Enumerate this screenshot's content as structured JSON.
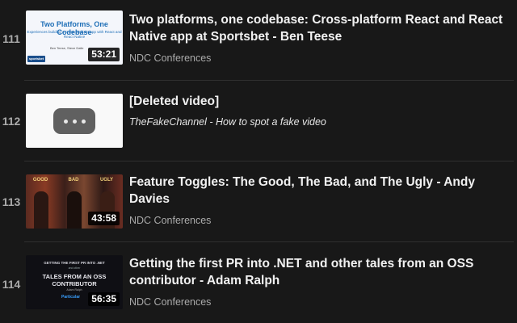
{
  "playlist": {
    "items": [
      {
        "index": "111",
        "title": "Two platforms, one codebase: Cross-platform React and React Native app at Sportsbet - Ben Teese",
        "channel": "NDC Conferences",
        "duration": "53:21",
        "thumb": {
          "heading": "Two Platforms, One Codebase",
          "subtitle": "Experiences building a cross-platform app with React and React Native",
          "author": "Ben Teese, Steve Dalle",
          "logo_text": "sportsbet"
        }
      },
      {
        "index": "112",
        "title": "[Deleted video]",
        "channel": "TheFakeChannel - How to spot a fake video",
        "duration": "",
        "thumb": {}
      },
      {
        "index": "113",
        "title": "Feature Toggles: The Good, The Bad, and The Ugly - Andy Davies",
        "channel": "NDC Conferences",
        "duration": "43:58",
        "thumb": {
          "labels": [
            "GOOD",
            "BAD",
            "UGLY"
          ]
        }
      },
      {
        "index": "114",
        "title": "Getting the first PR into .NET and other tales from an OSS contributor - Adam Ralph",
        "channel": "NDC Conferences",
        "duration": "56:35",
        "thumb": {
          "line1": "GETTING THE FIRST PR INTO .NET",
          "line2": "and other",
          "big": "TALES FROM AN OSS CONTRIBUTOR",
          "author": "Adam Ralph",
          "org": "Particular"
        }
      }
    ]
  },
  "colors": {
    "background": "#181818",
    "title": "#f1f1f1",
    "secondary": "#aaaaaa"
  }
}
